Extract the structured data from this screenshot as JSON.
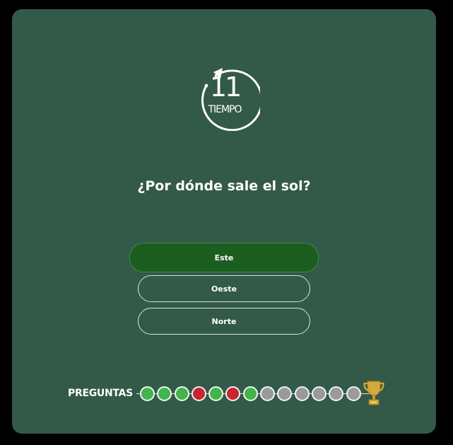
{
  "timer": {
    "value": "11",
    "label": "TIEMPO"
  },
  "question": {
    "text": "¿Por dónde sale el sol?"
  },
  "answers": [
    {
      "label": "Este",
      "selected": true
    },
    {
      "label": "Oeste",
      "selected": false
    },
    {
      "label": "Norte",
      "selected": false
    }
  ],
  "progress": {
    "label": "PREGUNTAS",
    "states": [
      "correct",
      "correct",
      "correct",
      "wrong",
      "correct",
      "wrong",
      "correct",
      "pending",
      "pending",
      "pending",
      "pending",
      "pending",
      "pending"
    ]
  },
  "colors": {
    "card_background": "#335948",
    "selected_answer": "#1b5e20",
    "correct": "#40b54a",
    "wrong": "#c9242f",
    "pending": "#9a9a9a",
    "trophy": "#d4a83a"
  },
  "icons": {
    "timer": "circular-arrow-icon",
    "goal": "trophy-icon"
  }
}
